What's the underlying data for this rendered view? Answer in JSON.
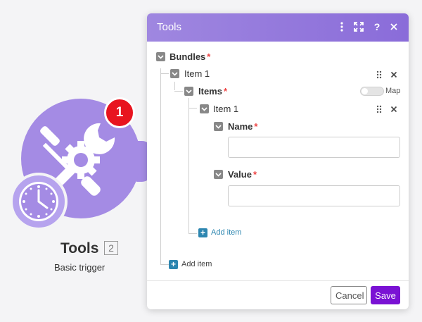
{
  "module": {
    "badge_count": "1",
    "title": "Tools",
    "count": "2",
    "subtitle": "Basic trigger",
    "main_icon": "tools-icon",
    "trigger_icon": "clock-icon",
    "accent_color": "#a48be4"
  },
  "dialog": {
    "title": "Tools",
    "header_icons": [
      "more-vert-icon",
      "expand-icon",
      "help-icon",
      "close-icon"
    ],
    "header_help_glyph": "?",
    "bundles_label": "Bundles",
    "bundle_item_label": "Item 1",
    "items_label": "Items",
    "map_label": "Map",
    "nested_item_label": "Item 1",
    "name_label": "Name",
    "name_value": "",
    "value_label": "Value",
    "value_value": "",
    "add_item_inner": "Add item",
    "add_item_outer": "Add item",
    "required_mark": "*",
    "cancel_label": "Cancel",
    "save_label": "Save",
    "save_color": "#7a12d4"
  }
}
